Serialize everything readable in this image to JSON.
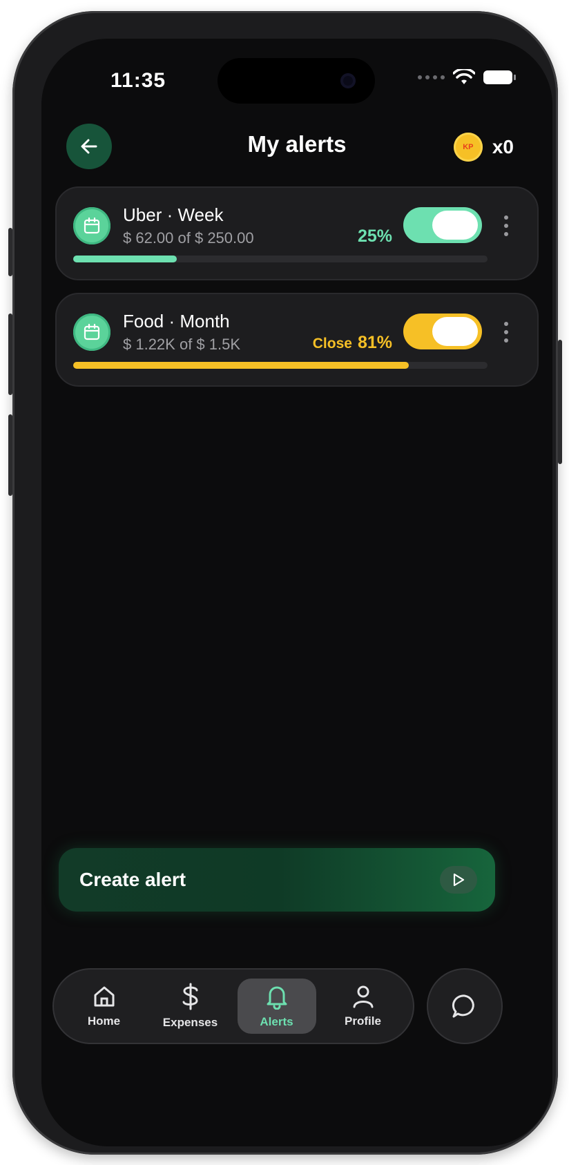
{
  "status_bar": {
    "time": "11:35"
  },
  "header": {
    "title": "My alerts",
    "coin_badge": "KP",
    "coin_count": "x0"
  },
  "alerts": [
    {
      "title": "Uber · Week",
      "amount_text": "$ 62.00 of $ 250.00",
      "status_prefix": "",
      "percent_label": "25%",
      "progress": 0.25,
      "enabled": true,
      "color": "#6de0b0"
    },
    {
      "title": "Food · Month",
      "amount_text": "$ 1.22K of $ 1.5K",
      "status_prefix": "Close",
      "percent_label": "81%",
      "progress": 0.81,
      "enabled": true,
      "color": "#f6c026"
    }
  ],
  "create_button": {
    "label": "Create alert"
  },
  "tabbar": {
    "items": [
      {
        "label": "Home",
        "icon": "home-icon"
      },
      {
        "label": "Expenses",
        "icon": "dollar-icon"
      },
      {
        "label": "Alerts",
        "icon": "bell-icon",
        "active": true
      },
      {
        "label": "Profile",
        "icon": "user-icon"
      }
    ]
  },
  "colors": {
    "accent_green": "#6de0b0",
    "accent_yellow": "#f6c026",
    "background": "#0c0c0d"
  }
}
